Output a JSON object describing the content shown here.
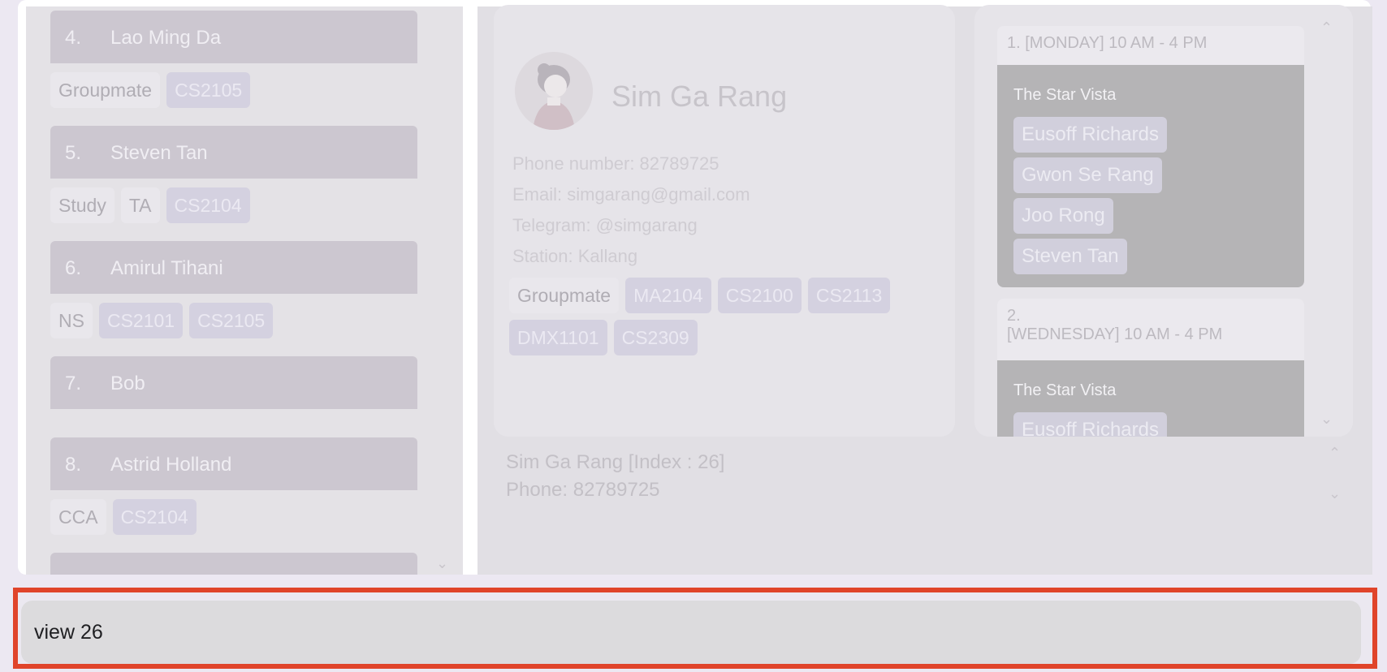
{
  "person_list": [
    {
      "index": "4.",
      "name": "Lao Ming Da",
      "tags": [
        "Groupmate"
      ],
      "modules": [
        "CS2105"
      ]
    },
    {
      "index": "5.",
      "name": "Steven Tan",
      "tags": [
        "Study",
        "TA"
      ],
      "modules": [
        "CS2104"
      ]
    },
    {
      "index": "6.",
      "name": "Amirul Tihani",
      "tags": [
        "NS"
      ],
      "modules": [
        "CS2101",
        "CS2105"
      ]
    },
    {
      "index": "7.",
      "name": "Bob",
      "tags": [],
      "modules": []
    },
    {
      "index": "8.",
      "name": "Astrid Holland",
      "tags": [
        "CCA"
      ],
      "modules": [
        "CS2104"
      ]
    }
  ],
  "person_detail": {
    "name": "Sim Ga Rang",
    "phone": "Phone number: 82789725",
    "email": "Email: simgarang@gmail.com",
    "telegram": "Telegram: @simgarang",
    "station": "Station: Kallang",
    "tags": [
      "Groupmate"
    ],
    "modules": [
      "MA2104",
      "CS2100",
      "CS2113",
      "DMX1101",
      "CS2309"
    ]
  },
  "meetups": [
    {
      "title": "1. [MONDAY] 10 AM - 4 PM",
      "location": "The Star Vista",
      "people": [
        "Eusoff Richards",
        "Gwon Se Rang",
        "Joo Rong",
        "Steven Tan"
      ]
    },
    {
      "title_line1": "2.",
      "title_line2": "[WEDNESDAY] 10 AM - 4 PM",
      "location": "The Star Vista",
      "people": [
        "Eusoff Richards"
      ]
    }
  ],
  "summary": {
    "line1": "Sim Ga Rang [Index : 26]",
    "line2": "Phone: 82789725"
  },
  "command": {
    "value": "view 26"
  },
  "colors": {
    "highlight_border": "#e0442a"
  }
}
